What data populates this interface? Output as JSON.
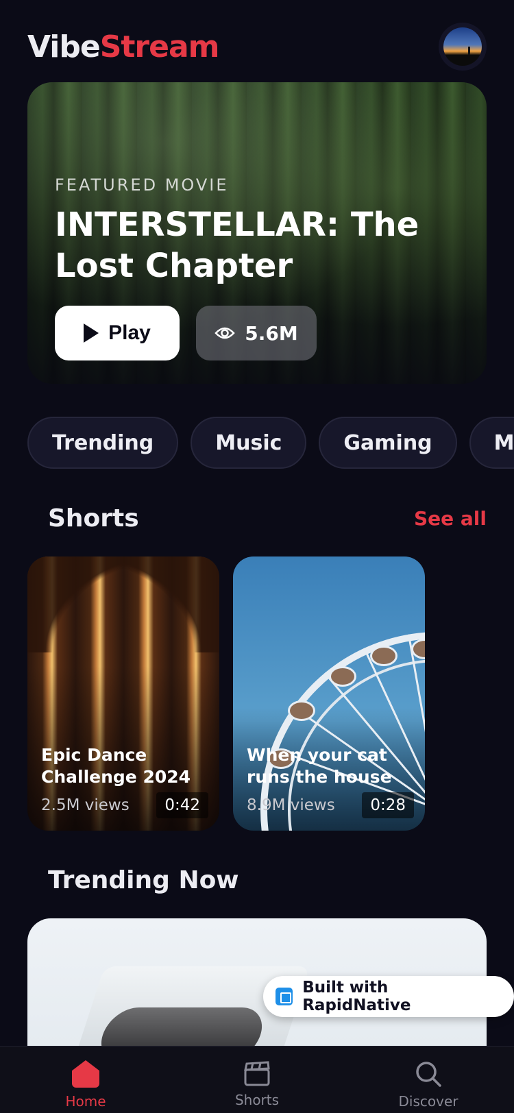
{
  "app": {
    "logo_part1": "Vibe",
    "logo_part2": "Stream",
    "accent_color": "#e63946"
  },
  "hero": {
    "label": "FEATURED MOVIE",
    "title": "INTERSTELLAR: The Lost Chapter",
    "play_label": "Play",
    "views_label": "5.6M"
  },
  "categories": [
    "Trending",
    "Music",
    "Gaming",
    "Movies"
  ],
  "shorts_section": {
    "title": "Shorts",
    "see_all": "See all",
    "items": [
      {
        "title": "Epic Dance Challenge 2024",
        "views": "2.5M views",
        "duration": "0:42"
      },
      {
        "title": "When your cat runs the house",
        "views": "8.9M views",
        "duration": "0:28"
      }
    ]
  },
  "trending_section": {
    "title": "Trending Now"
  },
  "badge": {
    "label": "Built with RapidNative"
  },
  "bottom_nav": [
    {
      "label": "Home",
      "icon": "home-icon",
      "active": true
    },
    {
      "label": "Shorts",
      "icon": "clapper-icon",
      "active": false
    },
    {
      "label": "Discover",
      "icon": "search-icon",
      "active": false
    }
  ]
}
